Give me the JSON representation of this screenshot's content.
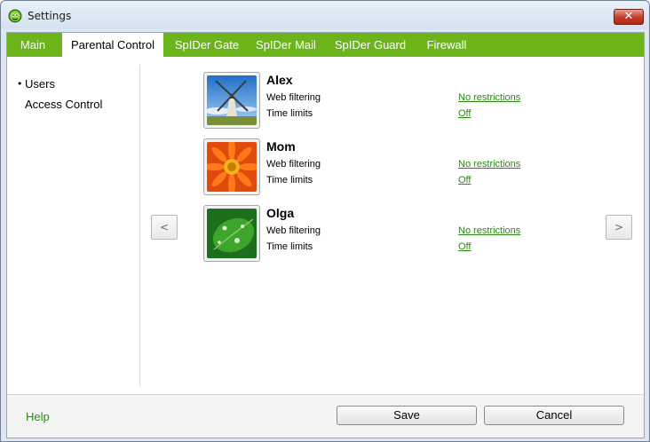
{
  "window": {
    "title": "Settings"
  },
  "tabs": [
    {
      "label": "Main",
      "active": false
    },
    {
      "label": "Parental Control",
      "active": true
    },
    {
      "label": "SpIDer Gate",
      "active": false
    },
    {
      "label": "SpIDer Mail",
      "active": false
    },
    {
      "label": "SpIDer Guard",
      "active": false
    },
    {
      "label": "Firewall",
      "active": false
    }
  ],
  "sidebar": {
    "items": [
      {
        "label": "Users",
        "selected": true
      },
      {
        "label": "Access Control",
        "selected": false
      }
    ]
  },
  "nav": {
    "prev": "<",
    "next": ">"
  },
  "users": [
    {
      "name": "Alex",
      "avatar": "windmill-picture",
      "web_label": "Web filtering",
      "web_value": "No restrictions",
      "time_label": "Time limits",
      "time_value": "Off"
    },
    {
      "name": "Mom",
      "avatar": "orange-flower-picture",
      "web_label": "Web filtering",
      "web_value": "No restrictions",
      "time_label": "Time limits",
      "time_value": "Off"
    },
    {
      "name": "Olga",
      "avatar": "green-leaf-picture",
      "web_label": "Web filtering",
      "web_value": "No restrictions",
      "time_label": "Time limits",
      "time_value": "Off"
    }
  ],
  "footer": {
    "help": "Help",
    "save": "Save",
    "cancel": "Cancel"
  },
  "colors": {
    "tab_bar": "#6bb51a",
    "link": "#2a8a10",
    "close_button": "#c5402c"
  }
}
